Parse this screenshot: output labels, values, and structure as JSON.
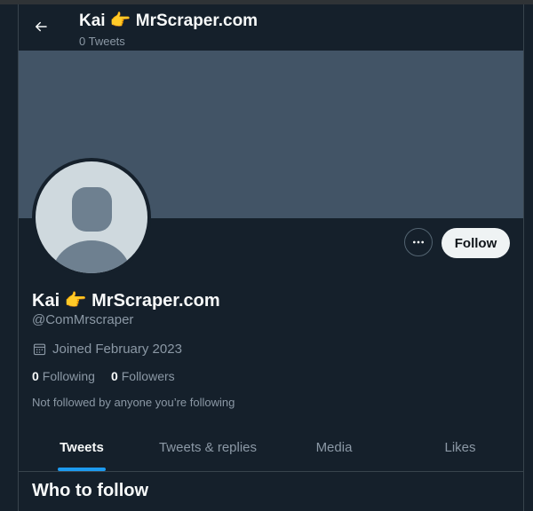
{
  "header": {
    "back_icon": "arrow-left-icon",
    "title": "Kai 👉 MrScraper.com",
    "subtitle": "0 Tweets"
  },
  "colors": {
    "background": "#15202b",
    "banner": "#425466",
    "accent": "#1d9bf0",
    "follow_button_bg": "#eff3f4",
    "secondary_text": "#8b98a5"
  },
  "profile": {
    "avatar_icon": "default-avatar-icon",
    "display_name": "Kai 👉 MrScraper.com",
    "handle": "@ComMrscraper",
    "joined_icon": "calendar-icon",
    "joined": "Joined February 2023",
    "following_count": "0",
    "following_label": "Following",
    "followers_count": "0",
    "followers_label": "Followers",
    "not_followed_text": "Not followed by anyone you’re following"
  },
  "actions": {
    "more_icon": "more-horizontal-icon",
    "follow_label": "Follow"
  },
  "tabs": [
    {
      "label": "Tweets",
      "active": true
    },
    {
      "label": "Tweets & replies",
      "active": false
    },
    {
      "label": "Media",
      "active": false
    },
    {
      "label": "Likes",
      "active": false
    }
  ],
  "who_to_follow": {
    "heading": "Who to follow"
  }
}
